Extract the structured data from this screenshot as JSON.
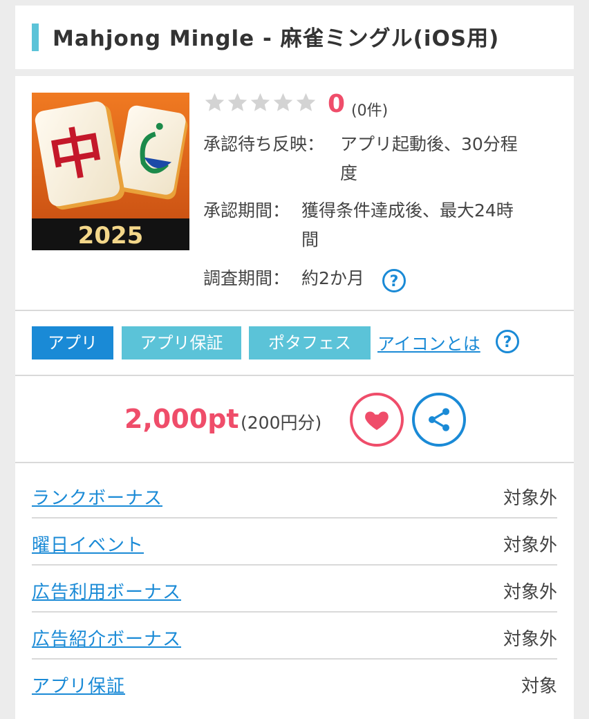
{
  "header": {
    "title": "Mahjong Mingle - 麻雀ミングル(iOS用)"
  },
  "app": {
    "icon_tile_char": "中",
    "icon_year": "2025",
    "rating": {
      "stars": 0,
      "max_stars": 5,
      "value": "0",
      "count": "(0件)"
    },
    "info": [
      {
        "label": "承認待ち反映：",
        "value_line1": "アプリ起動後、30分程",
        "value_line2": "度"
      },
      {
        "label": "承認期間：",
        "value_line1": "獲得条件達成後、最大24時",
        "value_line2": "間"
      },
      {
        "label": "調査期間：",
        "value_line1": "約2か月",
        "value_line2": ""
      }
    ]
  },
  "tags": {
    "app": "アプリ",
    "guarantee": "アプリ保証",
    "pota": "ポタフェス",
    "icon_help_link": "アイコンとは"
  },
  "reward": {
    "points": "2,000pt",
    "yen": "(200円分)"
  },
  "bonuses": [
    {
      "label": "ランクボーナス",
      "status": "対象外"
    },
    {
      "label": "曜日イベント",
      "status": "対象外"
    },
    {
      "label": "広告利用ボーナス",
      "status": "対象外"
    },
    {
      "label": "広告紹介ボーナス",
      "status": "対象外"
    },
    {
      "label": "アプリ保証",
      "status": "対象"
    }
  ],
  "colors": {
    "accent_pink": "#ef4d6a",
    "accent_blue": "#1a8ad6",
    "tag_teal": "#5bc3d8",
    "title_bar": "#5bc3d8"
  },
  "icons": [
    "star-icon",
    "help-icon",
    "heart-icon",
    "share-icon"
  ]
}
